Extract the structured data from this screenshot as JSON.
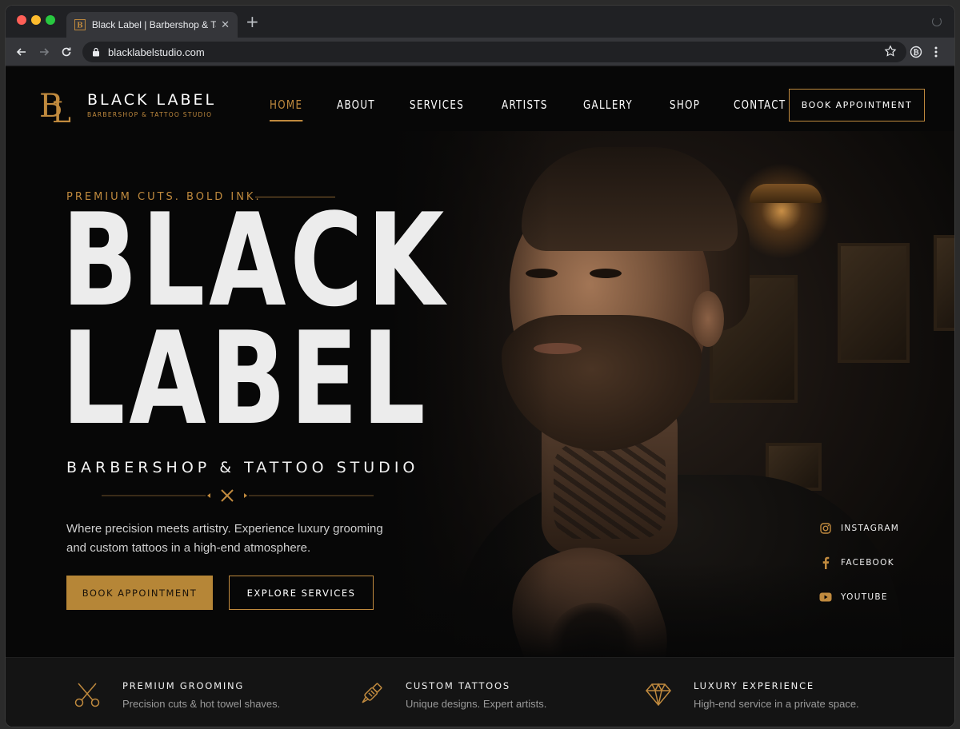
{
  "browser": {
    "tab_title": "Black Label | Barbershop & Tattoo Studio",
    "url": "blacklabelstudio.com"
  },
  "brand": {
    "monogram": "BL",
    "name": "BLACK LABEL",
    "tagline": "BARBERSHOP & TATTOO STUDIO"
  },
  "nav": {
    "items": [
      {
        "label": "HOME",
        "active": true
      },
      {
        "label": "ABOUT",
        "active": false
      },
      {
        "label": "SERVICES",
        "active": false
      },
      {
        "label": "ARTISTS",
        "active": false
      },
      {
        "label": "GALLERY",
        "active": false
      },
      {
        "label": "SHOP",
        "active": false
      },
      {
        "label": "CONTACT",
        "active": false
      }
    ],
    "cta_label": "BOOK APPOINTMENT"
  },
  "hero": {
    "eyebrow": "PREMIUM CUTS. BOLD INK.",
    "title_line1": "BLACK",
    "title_line2": "LABEL",
    "subtitle": "BARBERSHOP & TATTOO STUDIO",
    "description": "Where precision meets artistry. Experience luxury grooming and custom tattoos in a high-end atmosphere.",
    "primary_button": "BOOK APPOINTMENT",
    "secondary_button": "EXPLORE SERVICES"
  },
  "social": [
    {
      "label": "INSTAGRAM",
      "icon": "instagram-icon"
    },
    {
      "label": "FACEBOOK",
      "icon": "facebook-icon"
    },
    {
      "label": "YOUTUBE",
      "icon": "youtube-icon"
    }
  ],
  "features": [
    {
      "title": "PREMIUM GROOMING",
      "desc": "Precision cuts & hot towel shaves.",
      "icon": "scissors-icon"
    },
    {
      "title": "CUSTOM TATTOOS",
      "desc": "Unique designs. Expert artists.",
      "icon": "tattoo-machine-icon"
    },
    {
      "title": "LUXURY EXPERIENCE",
      "desc": "High-end service in a private space.",
      "icon": "diamond-icon"
    }
  ],
  "colors": {
    "accent": "#c08a3e",
    "button_fill": "#b68637",
    "background": "#070707",
    "feature_bar": "#141414"
  }
}
